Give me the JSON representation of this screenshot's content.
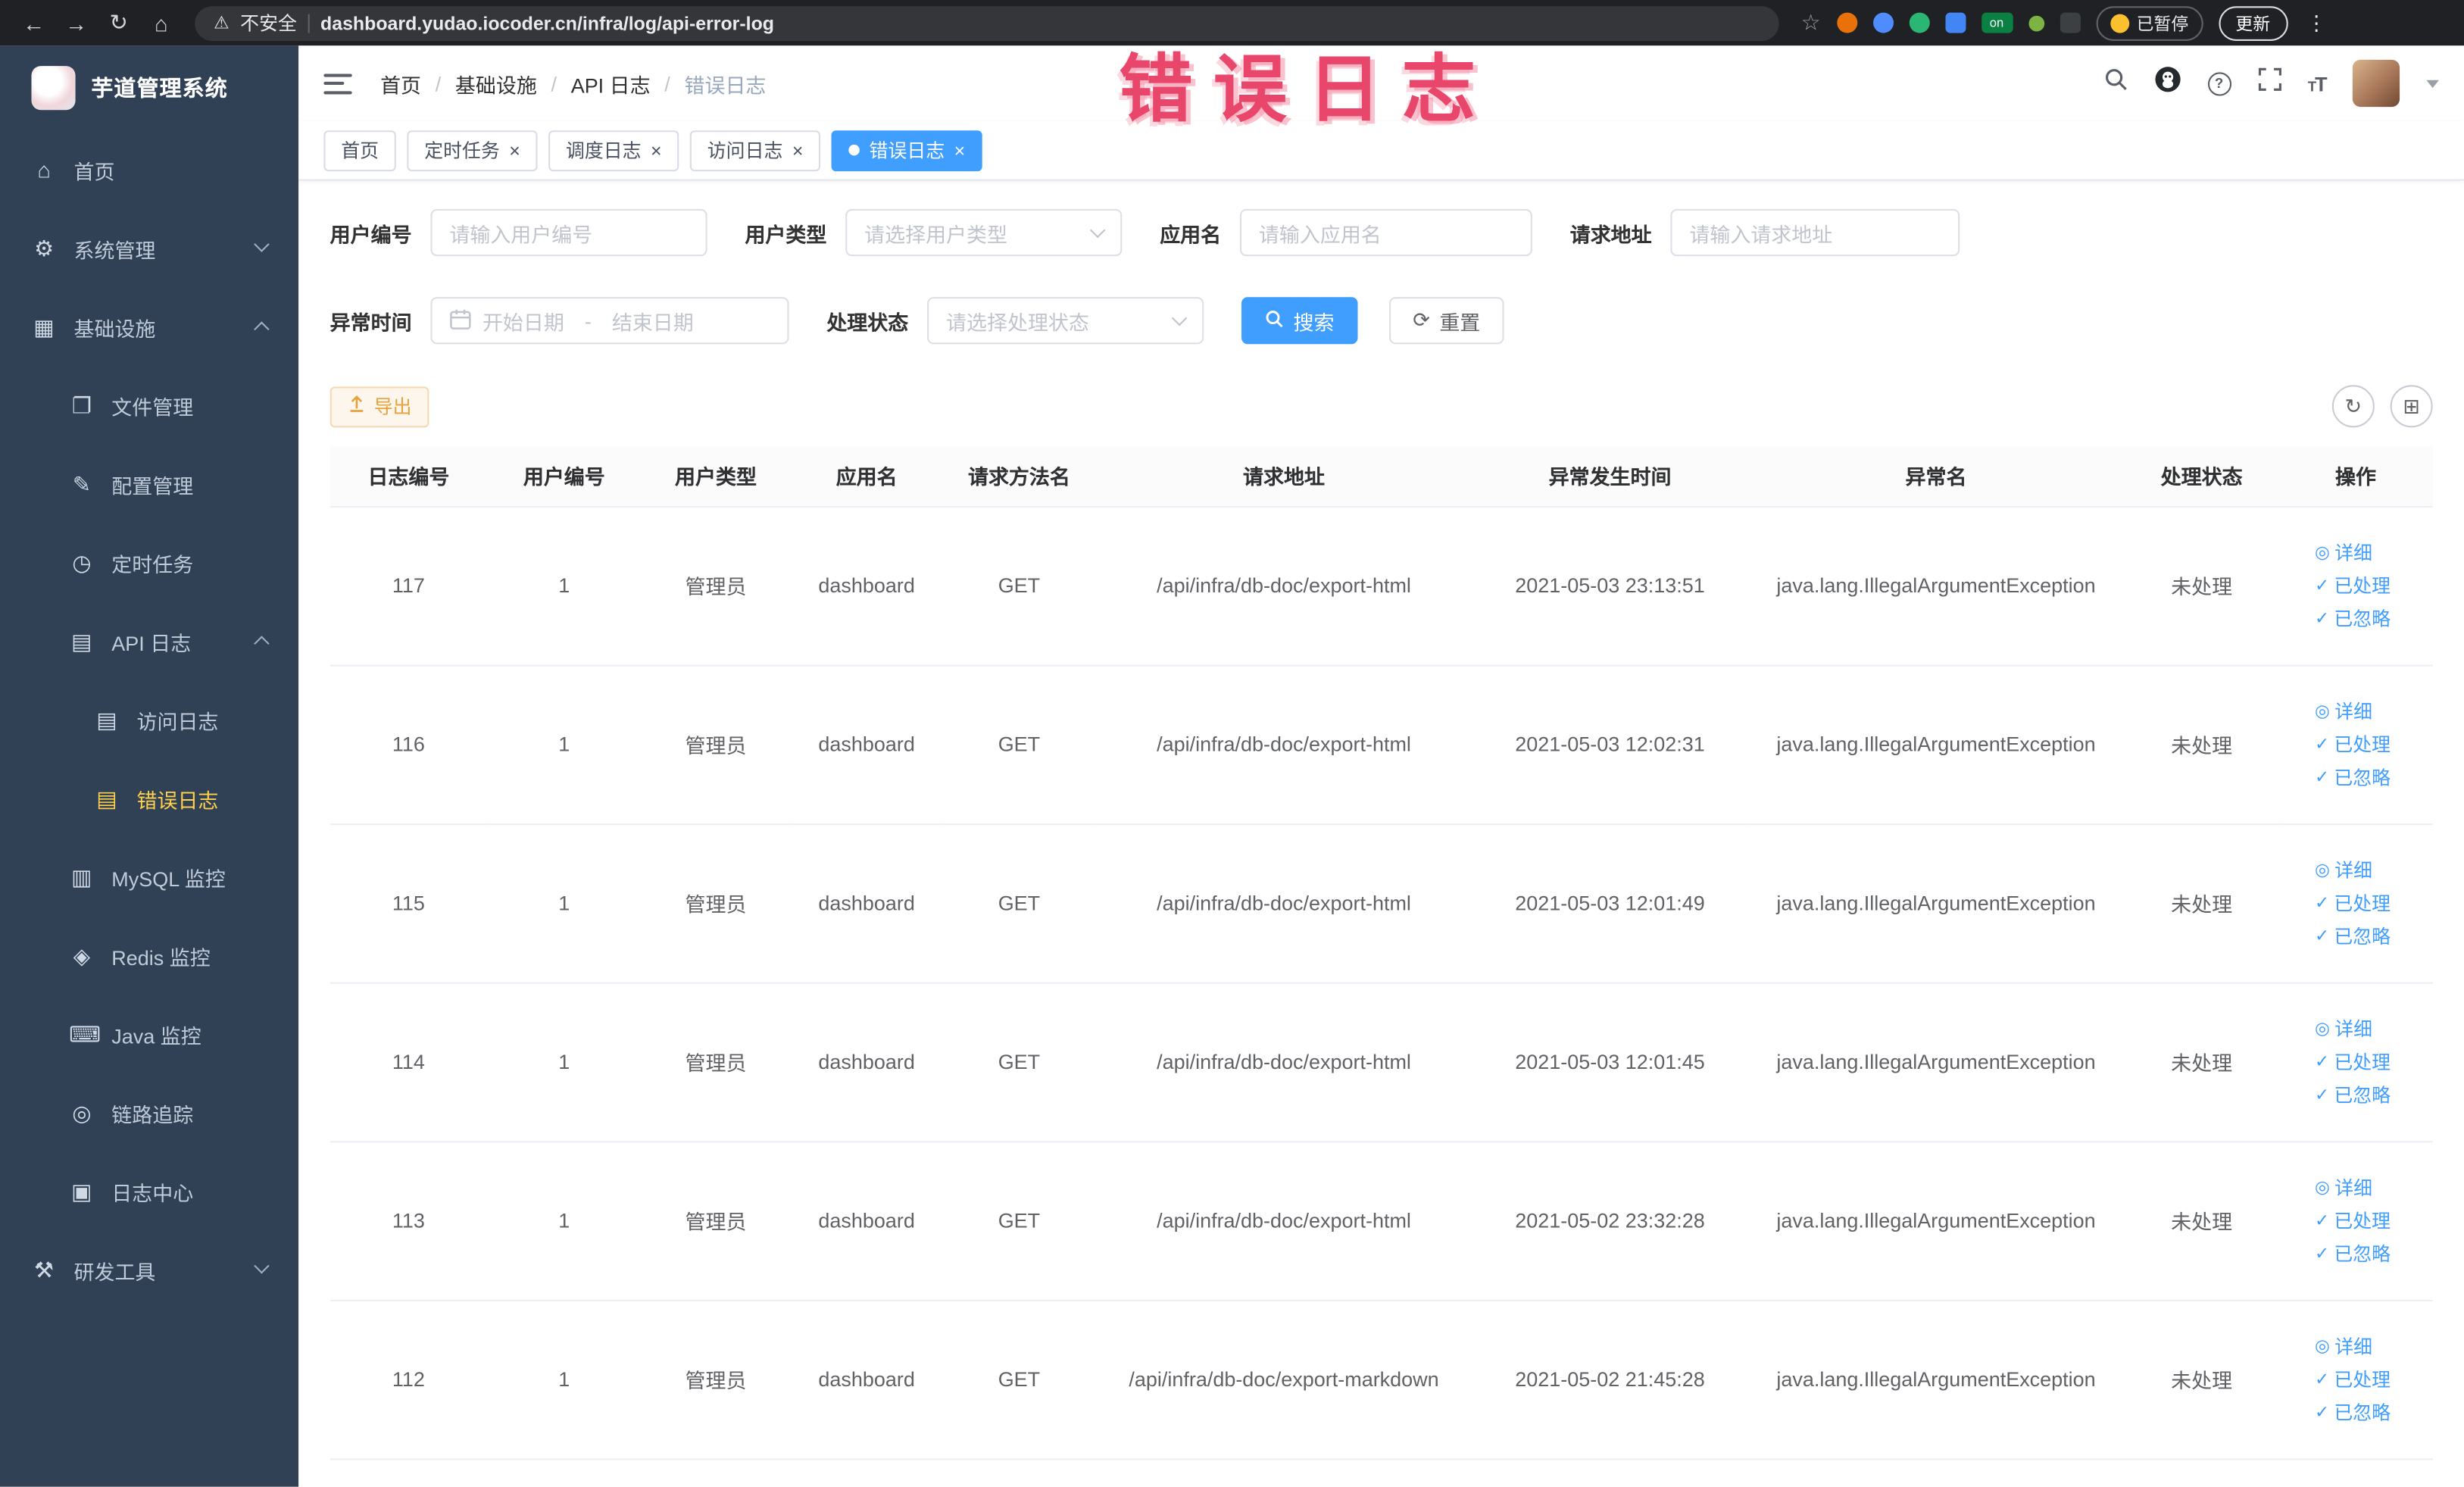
{
  "browser": {
    "security_label": "不安全",
    "url": "dashboard.yudao.iocoder.cn/infra/log/api-error-log",
    "paused_badge": "已暂停",
    "update_label": "更新",
    "extension_on": "on"
  },
  "watermark": "错误日志",
  "icons": {
    "back": "←",
    "forward": "→",
    "reload": "↻",
    "home": "⌂",
    "warning": "⚠",
    "star": "☆",
    "more": "⋮",
    "close": "×",
    "eye": "◎",
    "check": "✓",
    "reset": "⟳",
    "refresh": "↻",
    "columns": "⊞",
    "help": "?"
  },
  "sidebar": {
    "logo_title": "芋道管理系统",
    "items": [
      {
        "label": "首页",
        "icon": "⌂"
      },
      {
        "label": "系统管理",
        "icon": "⚙"
      },
      {
        "label": "基础设施",
        "icon": "▦"
      },
      {
        "label": "文件管理",
        "icon": "❐"
      },
      {
        "label": "配置管理",
        "icon": "✎"
      },
      {
        "label": "定时任务",
        "icon": "◷"
      },
      {
        "label": "API 日志",
        "icon": "▤"
      },
      {
        "label": "访问日志",
        "icon": "▤"
      },
      {
        "label": "错误日志",
        "icon": "▤"
      },
      {
        "label": "MySQL 监控",
        "icon": "▥"
      },
      {
        "label": "Redis 监控",
        "icon": "◈"
      },
      {
        "label": "Java 监控",
        "icon": "⌨"
      },
      {
        "label": "链路追踪",
        "icon": "◎"
      },
      {
        "label": "日志中心",
        "icon": "▣"
      },
      {
        "label": "研发工具",
        "icon": "⚒"
      }
    ]
  },
  "breadcrumb": [
    "首页",
    "基础设施",
    "API 日志",
    "错误日志"
  ],
  "tabs": [
    {
      "label": "首页"
    },
    {
      "label": "定时任务"
    },
    {
      "label": "调度日志"
    },
    {
      "label": "访问日志"
    },
    {
      "label": "错误日志"
    }
  ],
  "filters": {
    "user_id_label": "用户编号",
    "user_id_placeholder": "请输入用户编号",
    "user_type_label": "用户类型",
    "user_type_placeholder": "请选择用户类型",
    "app_name_label": "应用名",
    "app_name_placeholder": "请输入应用名",
    "request_url_label": "请求地址",
    "request_url_placeholder": "请输入请求地址",
    "exception_time_label": "异常时间",
    "start_date_placeholder": "开始日期",
    "date_separator": "-",
    "end_date_placeholder": "结束日期",
    "process_status_label": "处理状态",
    "process_status_placeholder": "请选择处理状态",
    "search_label": "搜索",
    "reset_label": "重置"
  },
  "toolbar": {
    "export_label": "导出"
  },
  "table": {
    "columns": [
      "日志编号",
      "用户编号",
      "用户类型",
      "应用名",
      "请求方法名",
      "请求地址",
      "异常发生时间",
      "异常名",
      "处理状态",
      "操作"
    ],
    "row_actions": [
      "详细",
      "已处理",
      "已忽略"
    ],
    "rows": [
      {
        "cells": [
          "117",
          "1",
          "管理员",
          "dashboard",
          "GET",
          "/api/infra/db-doc/export-html",
          "2021-05-03 23:13:51",
          "java.lang.IllegalArgumentException",
          "未处理"
        ]
      },
      {
        "cells": [
          "116",
          "1",
          "管理员",
          "dashboard",
          "GET",
          "/api/infra/db-doc/export-html",
          "2021-05-03 12:02:31",
          "java.lang.IllegalArgumentException",
          "未处理"
        ]
      },
      {
        "cells": [
          "115",
          "1",
          "管理员",
          "dashboard",
          "GET",
          "/api/infra/db-doc/export-html",
          "2021-05-03 12:01:49",
          "java.lang.IllegalArgumentException",
          "未处理"
        ]
      },
      {
        "cells": [
          "114",
          "1",
          "管理员",
          "dashboard",
          "GET",
          "/api/infra/db-doc/export-html",
          "2021-05-03 12:01:45",
          "java.lang.IllegalArgumentException",
          "未处理"
        ]
      },
      {
        "cells": [
          "113",
          "1",
          "管理员",
          "dashboard",
          "GET",
          "/api/infra/db-doc/export-html",
          "2021-05-02 23:32:28",
          "java.lang.IllegalArgumentException",
          "未处理"
        ]
      },
      {
        "cells": [
          "112",
          "1",
          "管理员",
          "dashboard",
          "GET",
          "/api/infra/db-doc/export-markdown",
          "2021-05-02 21:45:28",
          "java.lang.IllegalArgumentException",
          "未处理"
        ]
      }
    ]
  }
}
